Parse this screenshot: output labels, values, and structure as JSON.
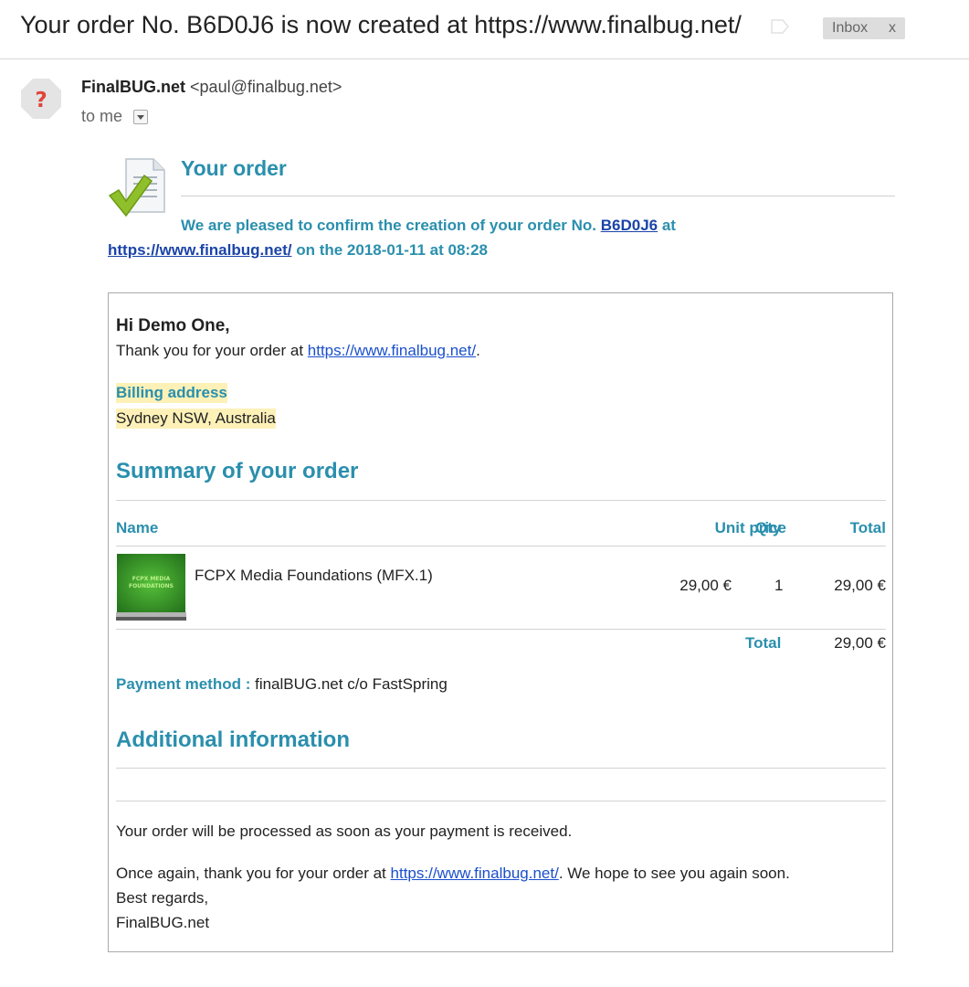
{
  "subject": {
    "title": "Your order No. B6D0J6 is now created at https://www.finalbug.net/",
    "inbox_label": "Inbox",
    "inbox_close": "x"
  },
  "sender": {
    "name": "FinalBUG.net",
    "email": "<paul@finalbug.net>",
    "to": "to me"
  },
  "header": {
    "title": "Your order",
    "confirm_prefix": "We are pleased to confirm the creation of your order No.",
    "order_no": "B6D0J6",
    "confirm_suffix_1": "at",
    "site_url": "https://www.finalbug.net/",
    "confirm_suffix_2": "on the 2018-01-11 at 08:28"
  },
  "body": {
    "greeting": "Hi Demo One,",
    "thanks_prefix": "Thank you for your order at",
    "thanks_url": "https://www.finalbug.net/",
    "thanks_suffix": ".",
    "billing_label": "Billing address",
    "billing_value": "Sydney NSW, Australia",
    "summary_title": "Summary of your order",
    "columns": {
      "name": "Name",
      "unit_price": "Unit price",
      "qty": "Qty",
      "total": "Total"
    },
    "items": [
      {
        "thumb_text_1": "FCPX MEDIA",
        "thumb_text_2": "FOUNDATIONS",
        "name": "FCPX Media Foundations (MFX.1)",
        "unit_price": "29,00 €",
        "qty": "1",
        "total": "29,00 €"
      }
    ],
    "total_label": "Total",
    "total_value": "29,00 €",
    "payment_label": "Payment method :",
    "payment_value": "finalBUG.net c/o FastSpring",
    "additional_title": "Additional information",
    "processed": "Your order will be processed as soon as your payment is received.",
    "again_prefix": "Once again, thank you for your order at",
    "again_url": "https://www.finalbug.net/",
    "again_suffix": ". We hope to see you again soon.",
    "regards": "Best regards,",
    "signature": "FinalBUG.net"
  },
  "colors": {
    "accent": "#2a8fad",
    "link": "#1a4fcc",
    "highlight": "#fdf1b8",
    "avatar_question": "#e0463a"
  }
}
